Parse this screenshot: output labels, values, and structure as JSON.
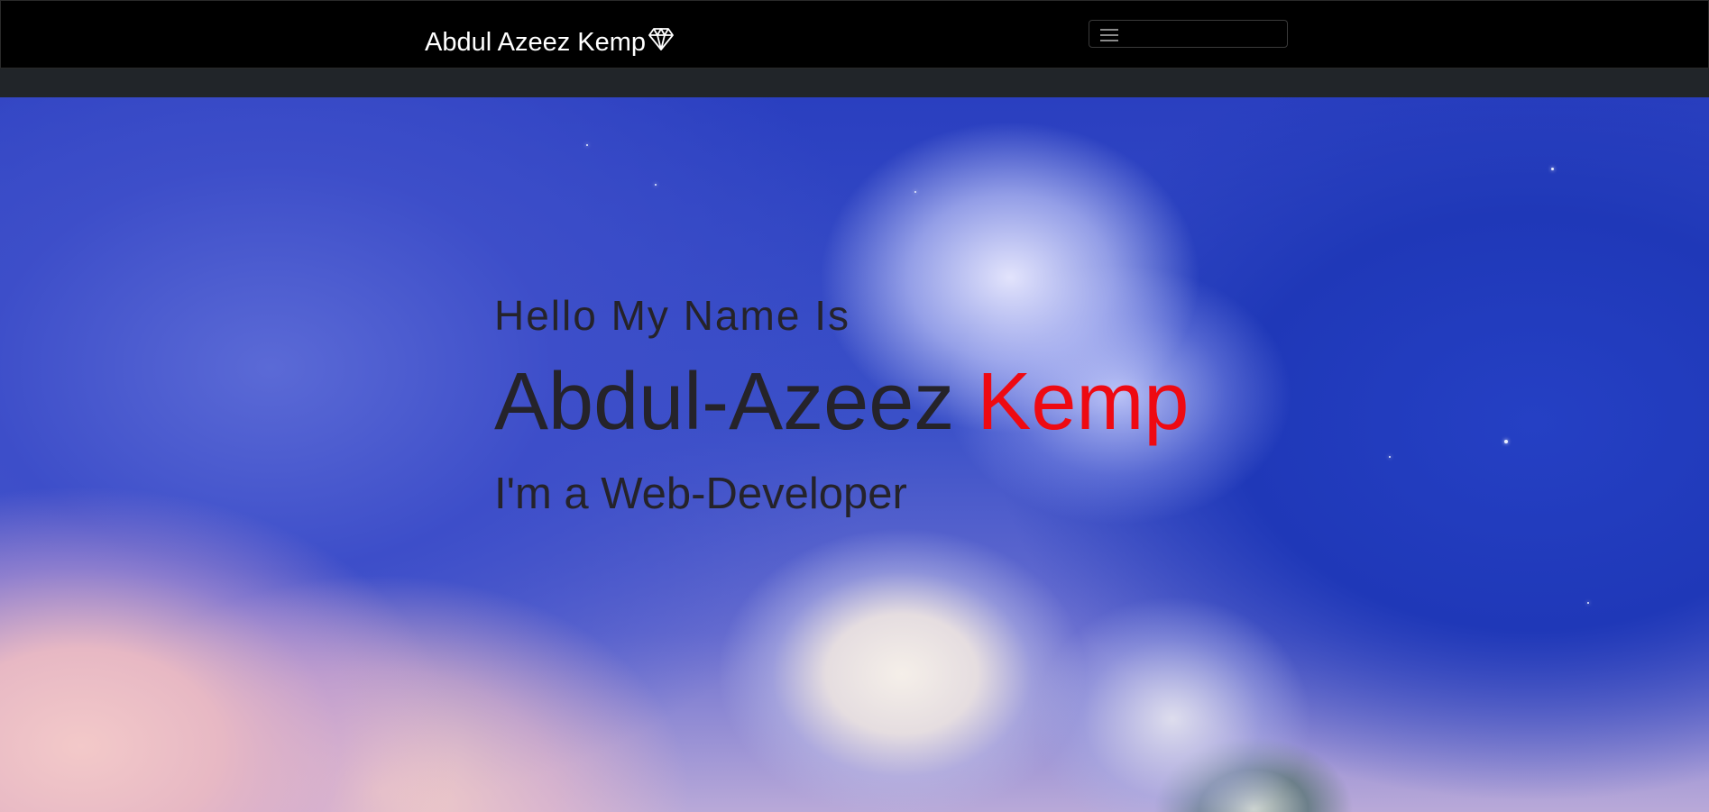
{
  "navbar": {
    "brand": "Abdul Azeez Kemp",
    "brand_icon": "gem-icon",
    "toggler_icon": "hamburger-icon",
    "background_color": "#000000"
  },
  "hero": {
    "greeting": "Hello My Name Is",
    "first_name": "Abdul-Azeez",
    "last_name": "Kemp",
    "role": "I'm a Web-Developer",
    "text_color": "#25232a",
    "accent_color": "#ee0a12",
    "background": "sky-clouds-illustration"
  }
}
